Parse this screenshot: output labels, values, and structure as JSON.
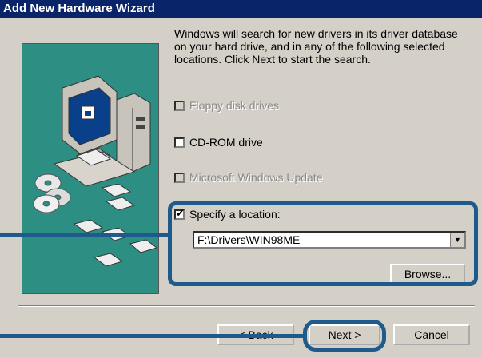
{
  "window": {
    "title": "Add New Hardware Wizard"
  },
  "description": "Windows will search for new drivers in its driver database on your hard drive, and in any of the following selected locations. Click Next to start the search.",
  "options": [
    {
      "label": "Floppy disk drives",
      "checked": false,
      "enabled": false
    },
    {
      "label": "CD-ROM drive",
      "checked": false,
      "enabled": true
    },
    {
      "label": "Microsoft Windows Update",
      "checked": false,
      "enabled": false
    },
    {
      "label": "Specify a location:",
      "checked": true,
      "enabled": true
    }
  ],
  "location_value": "F:\\Drivers\\WIN98ME",
  "buttons": {
    "browse": "Browse...",
    "back": "< Back",
    "next": "Next >",
    "cancel": "Cancel"
  },
  "colors": {
    "titlebar": "#0a246a",
    "side_panel": "#2d8f84",
    "highlight": "#1e5b8c",
    "dialog_bg": "#d4d0c8"
  },
  "icons": [
    "computer-icon",
    "cd-disc-icon",
    "floppy-disk-icon"
  ]
}
